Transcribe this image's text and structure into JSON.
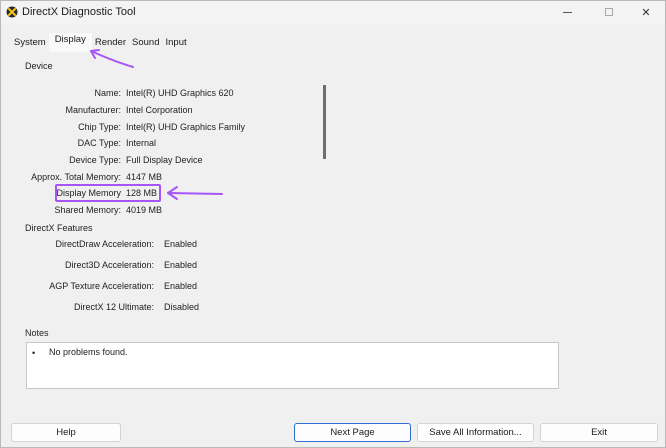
{
  "window": {
    "title": "DirectX Diagnostic Tool",
    "minimize": "",
    "maximize": "",
    "close": "✕"
  },
  "tabs": [
    {
      "label": "System",
      "active": false
    },
    {
      "label": "Display",
      "active": true
    },
    {
      "label": "Render",
      "active": false
    },
    {
      "label": "Sound",
      "active": false
    },
    {
      "label": "Input",
      "active": false
    }
  ],
  "device": {
    "section_title": "Device",
    "rows": [
      {
        "label": "Name:",
        "value": "Intel(R) UHD Graphics 620"
      },
      {
        "label": "Manufacturer:",
        "value": "Intel Corporation"
      },
      {
        "label": "Chip Type:",
        "value": "Intel(R) UHD Graphics Family"
      },
      {
        "label": "DAC Type:",
        "value": "Internal"
      },
      {
        "label": "Device Type:",
        "value": "Full Display Device"
      },
      {
        "label": "Approx. Total Memory:",
        "value": "4147 MB"
      },
      {
        "label": "Display Memory",
        "value": "128 MB"
      },
      {
        "label": "Shared Memory:",
        "value": "4019 MB"
      }
    ]
  },
  "features": {
    "section_title": "DirectX Features",
    "rows": [
      {
        "label": "DirectDraw Acceleration:",
        "value": "Enabled"
      },
      {
        "label": "Direct3D Acceleration:",
        "value": "Enabled"
      },
      {
        "label": "AGP Texture Acceleration:",
        "value": "Enabled"
      },
      {
        "label": "DirectX 12 Ultimate:",
        "value": "Disabled"
      }
    ]
  },
  "notes": {
    "section_title": "Notes",
    "bullet": "•",
    "items": [
      "No problems found."
    ]
  },
  "buttons": {
    "help": "Help",
    "next_page": "Next Page",
    "save_all": "Save All Information...",
    "exit": "Exit"
  },
  "annotation_color": "#a855f7"
}
